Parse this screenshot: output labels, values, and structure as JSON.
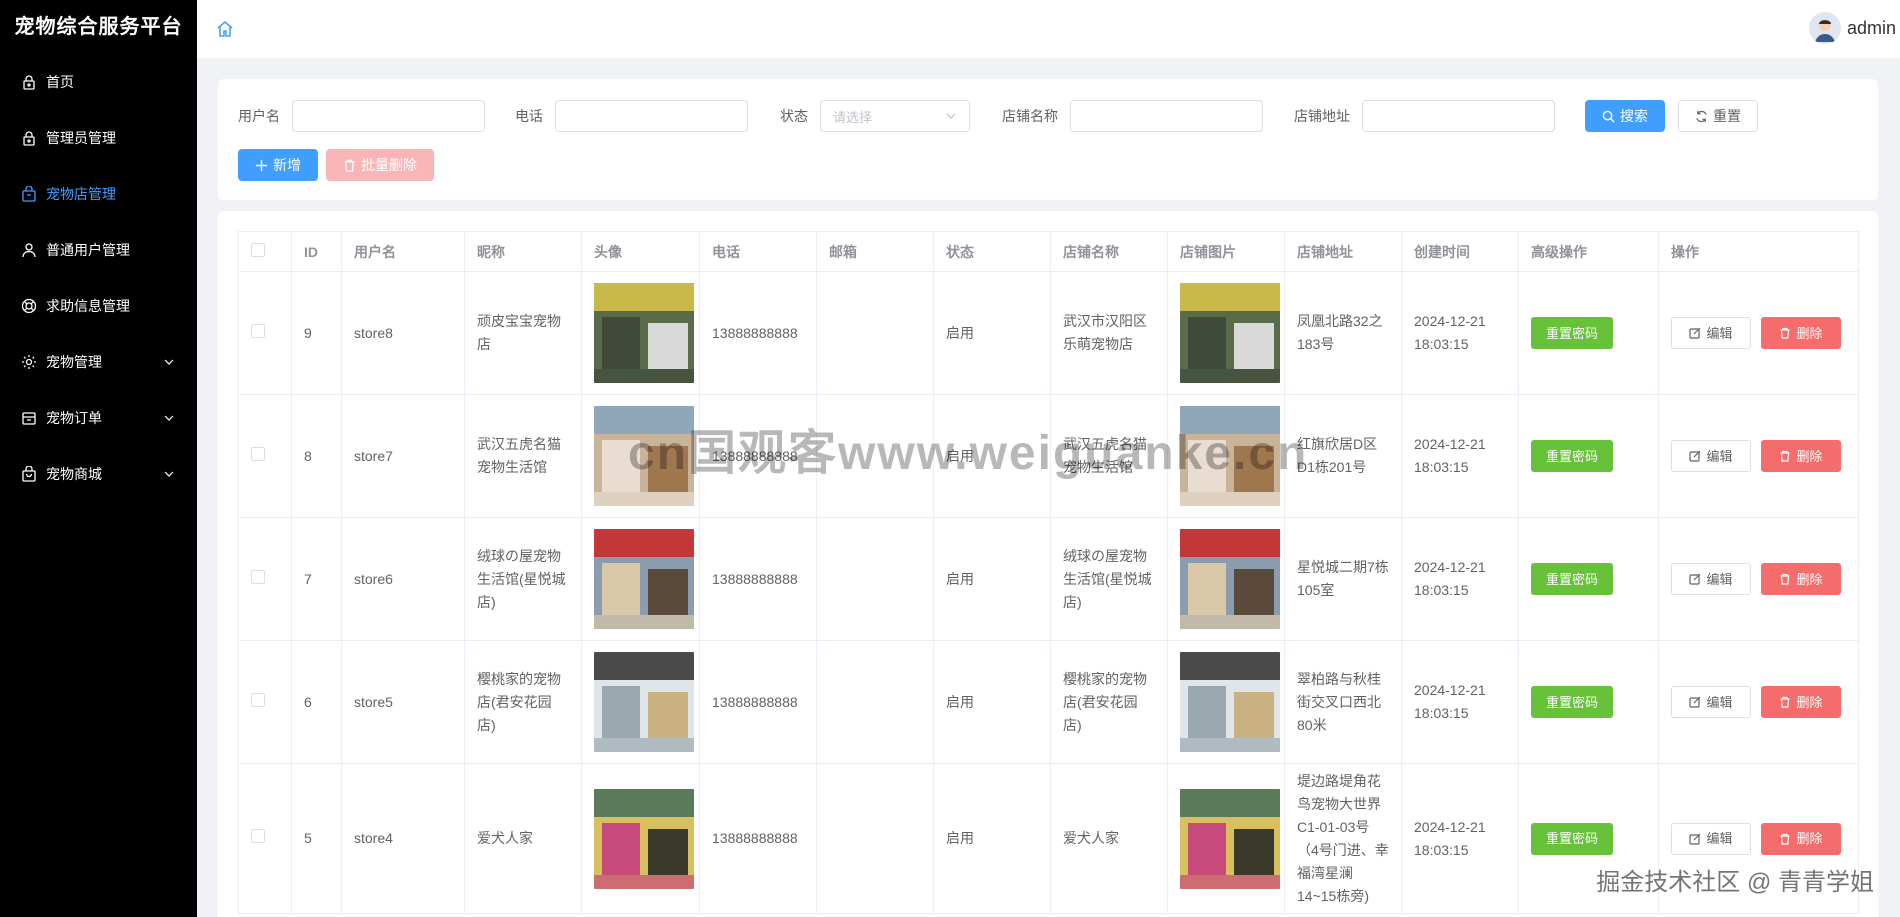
{
  "app": {
    "title": "宠物综合服务平台"
  },
  "sidebar": {
    "items": [
      {
        "label": "首页",
        "icon": "lock-icon",
        "active": false,
        "has_children": false
      },
      {
        "label": "管理员管理",
        "icon": "lock-icon",
        "active": false,
        "has_children": false
      },
      {
        "label": "宠物店管理",
        "icon": "shop-bag-icon",
        "active": true,
        "has_children": false
      },
      {
        "label": "普通用户管理",
        "icon": "user-icon",
        "active": false,
        "has_children": false
      },
      {
        "label": "求助信息管理",
        "icon": "help-ring-icon",
        "active": false,
        "has_children": false
      },
      {
        "label": "宠物管理",
        "icon": "gear-icon",
        "active": false,
        "has_children": true
      },
      {
        "label": "宠物订单",
        "icon": "box-icon",
        "active": false,
        "has_children": true
      },
      {
        "label": "宠物商城",
        "icon": "shopping-bag-icon",
        "active": false,
        "has_children": true
      }
    ]
  },
  "header": {
    "username": "admin"
  },
  "search": {
    "username_label": "用户名",
    "phone_label": "电话",
    "status_label": "状态",
    "status_placeholder": "请选择",
    "shop_name_label": "店铺名称",
    "shop_address_label": "店铺地址",
    "search_button": "搜索",
    "reset_button": "重置",
    "add_button": "新增",
    "batch_delete_button": "批量删除"
  },
  "table": {
    "columns": [
      "ID",
      "用户名",
      "昵称",
      "头像",
      "电话",
      "邮箱",
      "状态",
      "店铺名称",
      "店铺图片",
      "店铺地址",
      "创建时间",
      "高级操作",
      "操作"
    ],
    "reset_password_label": "重置密码",
    "edit_label": "编辑",
    "delete_label": "删除",
    "rows": [
      {
        "id": "9",
        "username": "store8",
        "nickname": "顽皮宝宝宠物店",
        "phone": "13888888888",
        "email": "",
        "status": "启用",
        "shop_name": "武汉市汉阳区乐萌宠物店",
        "address": "凤凰北路32之183号",
        "created": "2024-12-21 18:03:15"
      },
      {
        "id": "8",
        "username": "store7",
        "nickname": "武汉五虎名猫宠物生活馆",
        "phone": "13888888888",
        "email": "",
        "status": "启用",
        "shop_name": "武汉五虎名猫宠物生活馆",
        "address": "红旗欣居D区D1栋201号",
        "created": "2024-12-21 18:03:15"
      },
      {
        "id": "7",
        "username": "store6",
        "nickname": "绒球の屋宠物生活馆(星悦城店)",
        "phone": "13888888888",
        "email": "",
        "status": "启用",
        "shop_name": "绒球の屋宠物生活馆(星悦城店)",
        "address": "星悦城二期7栋105室",
        "created": "2024-12-21 18:03:15"
      },
      {
        "id": "6",
        "username": "store5",
        "nickname": "樱桃家的宠物店(君安花园店)",
        "phone": "13888888888",
        "email": "",
        "status": "启用",
        "shop_name": "樱桃家的宠物店(君安花园店)",
        "address": "翠柏路与秋桂街交叉口西北80米",
        "created": "2024-12-21 18:03:15"
      },
      {
        "id": "5",
        "username": "store4",
        "nickname": "爱犬人家",
        "phone": "13888888888",
        "email": "",
        "status": "启用",
        "shop_name": "爱犬人家",
        "address": "堤边路堤角花鸟宠物大世界C1-01-03号（4号门进、幸福湾星澜14~15栋旁)",
        "created": "2024-12-21 18:03:15"
      }
    ]
  },
  "watermarks": {
    "center": "cn国观客www.weiguanke.cn",
    "corner": "掘金技术社区 @ 青青学姐"
  },
  "colors": {
    "primary": "#409eff",
    "success": "#67c23a",
    "danger": "#f56c6c",
    "sidebar_bg": "#000000"
  }
}
